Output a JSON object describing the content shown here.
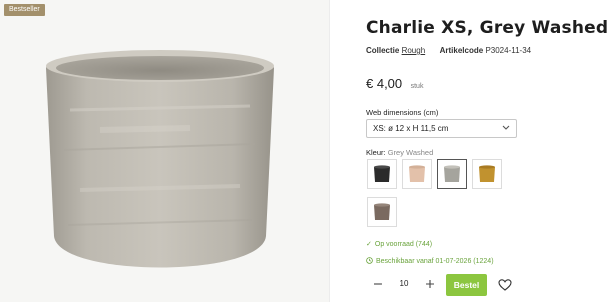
{
  "badge": "Bestseller",
  "product": {
    "title": "Charlie XS, Grey Washed",
    "collection_label": "Collectie",
    "collection_value": "Rough",
    "article_label": "Artikelcode",
    "article_value": "P3024-11-34",
    "price": "€ 4,00",
    "price_unit": "stuk"
  },
  "dimensions": {
    "label": "Web dimensions (cm)",
    "selected": "XS: ø 12 x H 11,5 cm"
  },
  "color": {
    "label": "Kleur:",
    "selected": "Grey Washed",
    "swatches": [
      {
        "name": "black",
        "hex": "#2b2b2b"
      },
      {
        "name": "blush",
        "hex": "#e3c1aa"
      },
      {
        "name": "grey-washed",
        "hex": "#a5a49d",
        "active": true
      },
      {
        "name": "gold",
        "hex": "#c1922f"
      },
      {
        "name": "brown",
        "hex": "#7a6a60"
      }
    ]
  },
  "stock": {
    "in_stock": "Op voorraad (744)",
    "available_from": "Beschikbaar vanaf 01-07-2026 (1224)"
  },
  "cart": {
    "quantity": "10",
    "order_label": "Bestel"
  },
  "colors": {
    "accent_green": "#8cc63f",
    "badge_bg": "#a3906b"
  }
}
